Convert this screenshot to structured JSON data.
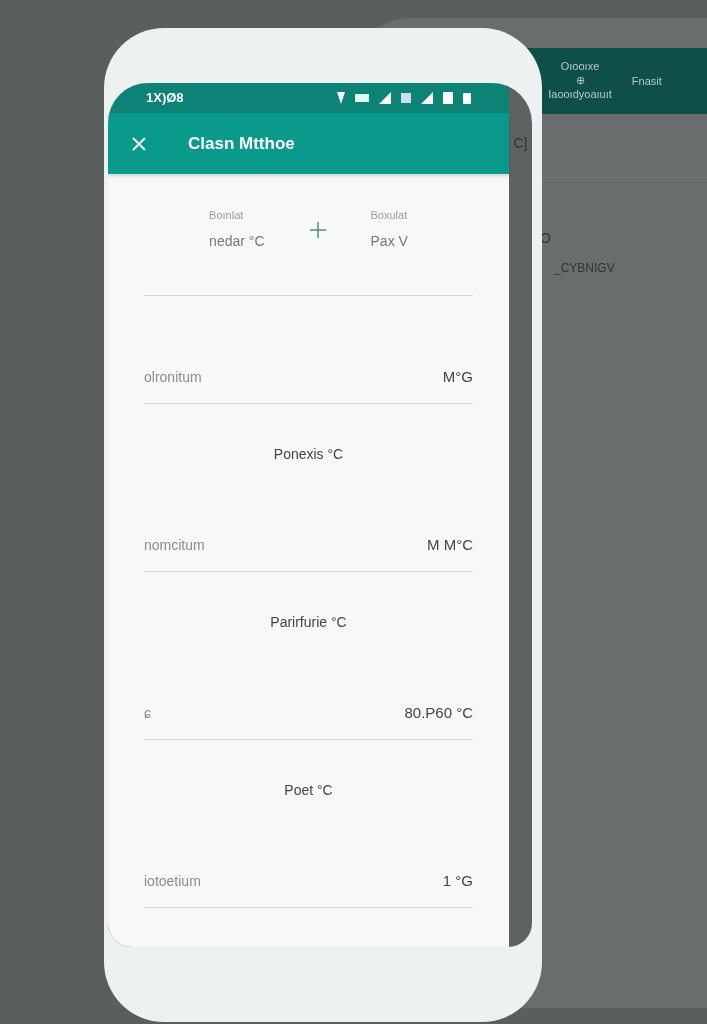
{
  "back_phone": {
    "header_items": [
      "Oıooıxe",
      "⊕",
      "Iaooıdyoaıuıt",
      "Fnasit"
    ],
    "items": [
      "C]",
      "O",
      "_CYBNIGV"
    ]
  },
  "status_bar": {
    "time": "1X)Ø8"
  },
  "app_bar": {
    "title": "Clasn Mtthoe"
  },
  "summary": [
    {
      "label": "Boınlat",
      "value": "nedar °C"
    },
    {
      "label": "Boxulat",
      "value": "Pax V"
    }
  ],
  "sections": [
    {
      "label": "olronitum",
      "value": "M°G"
    },
    {
      "header": "Ponexis °C",
      "label": "nomcitum",
      "value": "M M°C"
    },
    {
      "header": "Parirfurie °C",
      "label": "ɕ",
      "value": "80.P60 °C"
    },
    {
      "header": "Poet °C",
      "label": "iotoetium",
      "value": "1 °G"
    }
  ]
}
